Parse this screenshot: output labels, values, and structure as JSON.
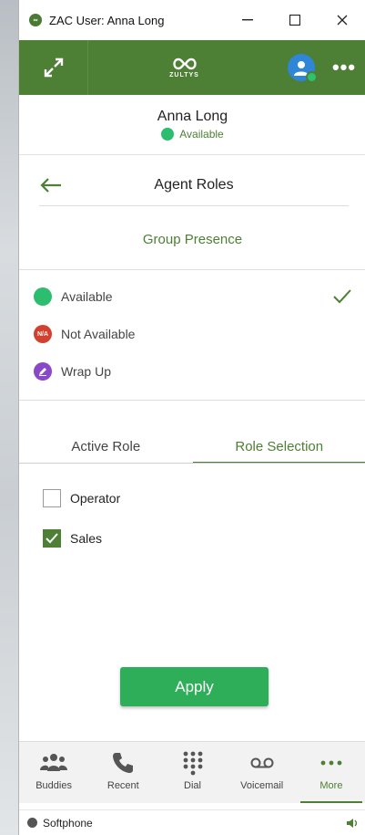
{
  "window": {
    "title": "ZAC User: Anna Long",
    "controls": {
      "minimize": "—",
      "maximize": "☐",
      "close": "✕"
    }
  },
  "header": {
    "logo_text": "ZULTYS",
    "more_label": "•••"
  },
  "user": {
    "name": "Anna Long",
    "status": "Available",
    "status_color": "#2dbd6e"
  },
  "page": {
    "title": "Agent Roles",
    "section_title": "Group Presence"
  },
  "presence": [
    {
      "label": "Available",
      "icon": "green-dot-icon",
      "color": "#2dbd6e",
      "selected": true
    },
    {
      "label": "Not Available",
      "icon": "na-badge-icon",
      "color": "#d2402f",
      "badge": "N/A",
      "selected": false
    },
    {
      "label": "Wrap Up",
      "icon": "pencil-icon",
      "color": "#8a48c8",
      "selected": false
    }
  ],
  "tabs": [
    {
      "label": "Active Role",
      "active": false
    },
    {
      "label": "Role Selection",
      "active": true
    }
  ],
  "roles": [
    {
      "label": "Operator",
      "checked": false
    },
    {
      "label": "Sales",
      "checked": true
    }
  ],
  "apply_label": "Apply",
  "bottom_nav": [
    {
      "label": "Buddies",
      "icon": "buddies-icon",
      "active": false
    },
    {
      "label": "Recent",
      "icon": "phone-icon",
      "active": false
    },
    {
      "label": "Dial",
      "icon": "dialpad-icon",
      "active": false
    },
    {
      "label": "Voicemail",
      "icon": "voicemail-icon",
      "active": false
    },
    {
      "label": "More",
      "icon": "more-dots-icon",
      "active": true
    }
  ],
  "status_bar": {
    "label": "Softphone",
    "icon": "speaker-icon"
  },
  "colors": {
    "brand_green": "#4d7f35",
    "apply_green": "#2fae5a",
    "avatar_blue": "#2f86d6"
  }
}
